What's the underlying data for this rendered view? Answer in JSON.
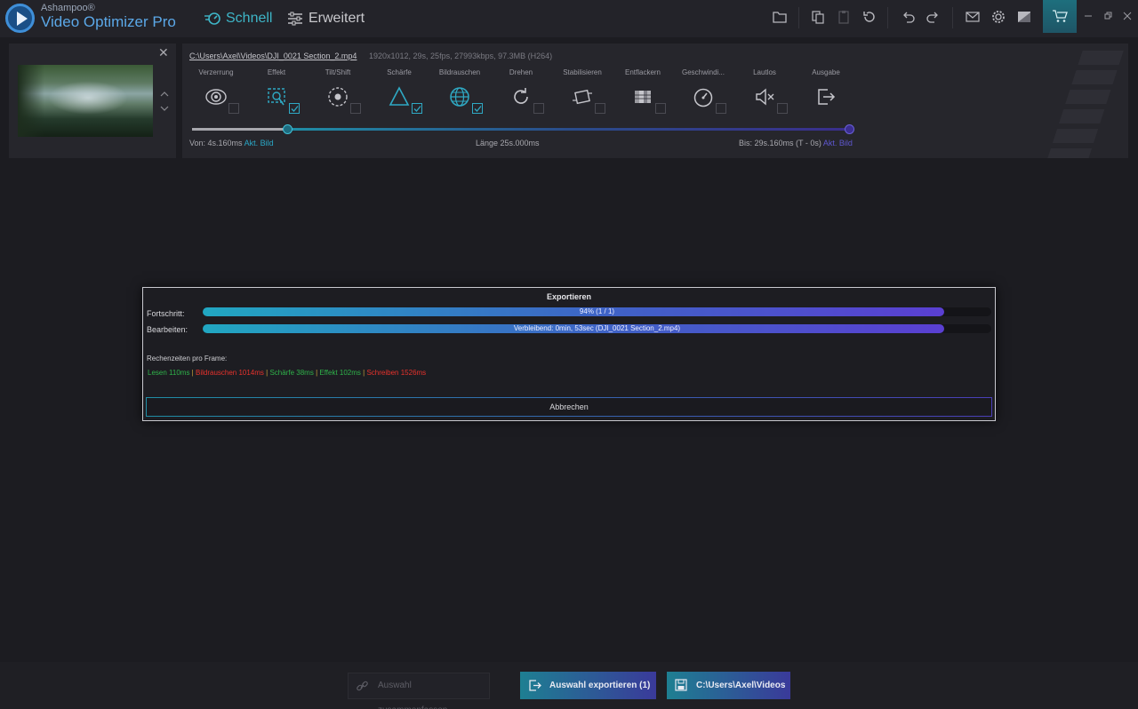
{
  "app": {
    "brand_top": "Ashampoo®",
    "brand_main": "Video Optimizer Pro"
  },
  "modes": {
    "schnell": "Schnell",
    "erweitert": "Erweitert"
  },
  "clip": {
    "file_path": "C:\\Users\\Axel\\Videos\\DJI_0021 Section_2.mp4",
    "file_info": "1920x1012, 29s, 25fps, 27993kbps, 97.3MB (H264)"
  },
  "tools": [
    {
      "label": "Verzerrung",
      "icon": "eye-icon",
      "checked": false
    },
    {
      "label": "Effekt",
      "icon": "effect-icon",
      "checked": true
    },
    {
      "label": "Tilt/Shift",
      "icon": "tiltshift-icon",
      "checked": false
    },
    {
      "label": "Schärfe",
      "icon": "sharpness-icon",
      "checked": true
    },
    {
      "label": "Bildrauschen",
      "icon": "noise-icon",
      "checked": true
    },
    {
      "label": "Drehen",
      "icon": "rotate-icon",
      "checked": false
    },
    {
      "label": "Stabilisieren",
      "icon": "stabilize-icon",
      "checked": false
    },
    {
      "label": "Entflackern",
      "icon": "deflicker-icon",
      "checked": false
    },
    {
      "label": "Geschwindi...",
      "icon": "speed-icon",
      "checked": false
    },
    {
      "label": "Lautlos",
      "icon": "mute-icon",
      "checked": false
    },
    {
      "label": "Ausgabe",
      "icon": "output-icon",
      "checked": false
    }
  ],
  "range": {
    "from_label": "Von: 4s.160ms",
    "from_link": "Akt. Bild",
    "length_label": "Länge 25s.000ms",
    "to_label": "Bis: 29s.160ms (T - 0s)",
    "to_link": "Akt. Bild"
  },
  "dialog": {
    "title": "Exportieren",
    "progress_label": "Fortschritt:",
    "progress_text": "94% (1 / 1)",
    "progress_fraction": 0.94,
    "processing_label": "Bearbeiten:",
    "processing_text": "Verbleibend:   0min, 53sec (DJI_0021 Section_2.mp4)",
    "processing_fraction": 0.94,
    "timing_label": "Rechenzeiten pro Frame:",
    "timings": {
      "lesen": "Lesen 110ms",
      "bildrauschen": "Bildrauschen 1014ms",
      "schaerfe": "Schärfe 38ms",
      "effekt": "Effekt 102ms",
      "schreiben": "Schreiben 1526ms",
      "separator": "|"
    },
    "cancel_label": "Abbrechen"
  },
  "bottom": {
    "merge_label": "Auswahl zusammenfassen...",
    "export_label": "Auswahl exportieren (1)",
    "path_label": "C:\\Users\\Axel\\Videos"
  },
  "colors": {
    "accent_teal": "#2aa7c6",
    "accent_violet": "#5e57d0",
    "timing_fast": "#2fb34a",
    "timing_slow": "#e8322c"
  }
}
